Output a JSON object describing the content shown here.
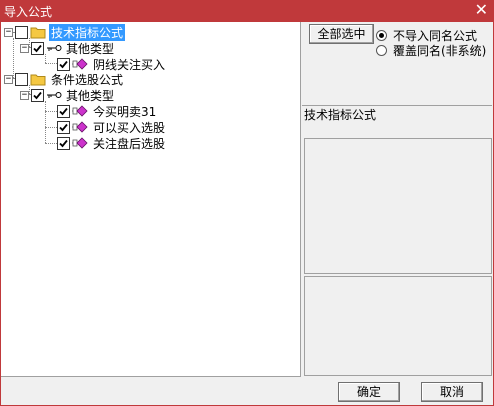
{
  "window": {
    "title": "导入公式",
    "close_glyph": "✕"
  },
  "tree": {
    "root_nodes": [
      {
        "expander": "−",
        "label": "技术指标公式",
        "checked": false,
        "selected": true,
        "children": [
          {
            "expander": "−",
            "label": "其他类型",
            "checked": true,
            "children": [
              {
                "label": "阴线关注买入",
                "checked": true
              }
            ]
          }
        ]
      },
      {
        "expander": "−",
        "label": "条件选股公式",
        "checked": false,
        "selected": false,
        "children": [
          {
            "expander": "−",
            "label": "其他类型",
            "checked": true,
            "children": [
              {
                "label": "今买明卖31",
                "checked": true
              },
              {
                "label": "可以买入选股",
                "checked": true
              },
              {
                "label": "关注盘后选股",
                "checked": true
              }
            ]
          }
        ]
      }
    ]
  },
  "options": {
    "select_all_label": "全部选中",
    "radio_no_import": "不导入同名公式",
    "radio_overwrite": "覆盖同名(非系统)",
    "selected_radio": "no_import"
  },
  "info": {
    "group_label": "技术指标公式"
  },
  "footer": {
    "ok_label": "确定",
    "cancel_label": "取消"
  },
  "colors": {
    "title_bar": "#c0393b",
    "selection": "#3399ff",
    "folder": "#f5c842",
    "formula_icon": "#cc33cc"
  }
}
